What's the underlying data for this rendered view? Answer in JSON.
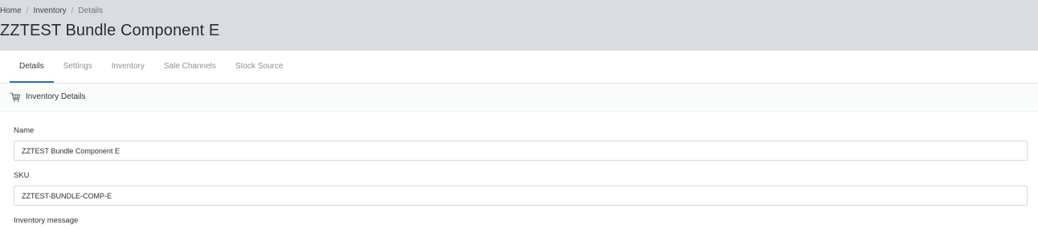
{
  "breadcrumb": {
    "items": [
      "Home",
      "Inventory",
      "Details"
    ],
    "separator": "/"
  },
  "page": {
    "title": "ZZTEST Bundle Component E"
  },
  "tabs": [
    {
      "label": "Details",
      "active": true
    },
    {
      "label": "Settings",
      "active": false
    },
    {
      "label": "Inventory",
      "active": false
    },
    {
      "label": "Sale Channels",
      "active": false
    },
    {
      "label": "Stock Source",
      "active": false
    }
  ],
  "section": {
    "title": "Inventory Details",
    "icon": "cart-icon"
  },
  "form": {
    "name_label": "Name",
    "name_value": "ZZTEST Bundle Component E",
    "sku_label": "SKU",
    "sku_value": "ZZTEST-BUNDLE-COMP-E",
    "inventory_message_label": "Inventory message"
  },
  "colors": {
    "header_bg": "#d9dde1",
    "active_tab_underline": "#2f6fb0"
  }
}
